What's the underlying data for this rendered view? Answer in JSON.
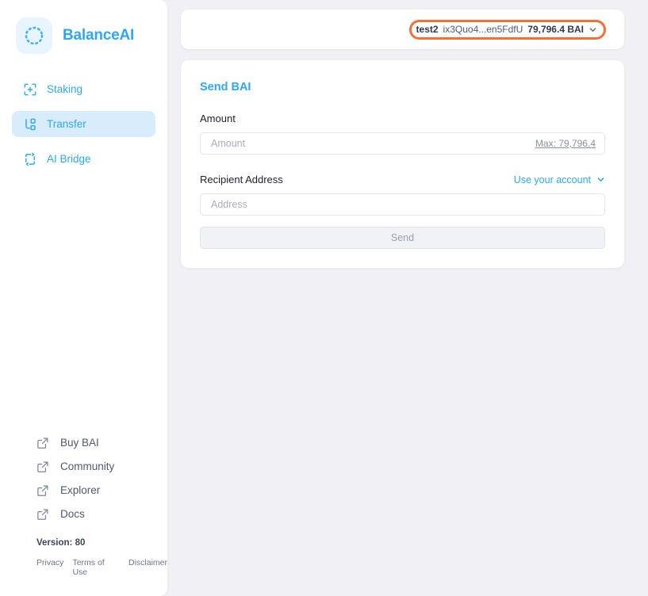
{
  "brand": {
    "name": "BalanceAI",
    "logo_icon": "dashed-circle-logo",
    "accent_color": "#2ea8f0"
  },
  "sidebar": {
    "nav": [
      {
        "label": "Staking",
        "icon": "scan-plus-icon",
        "active": false
      },
      {
        "label": "Transfer",
        "icon": "git-branch-icon",
        "active": true
      },
      {
        "label": "AI Bridge",
        "icon": "refresh-cycle-icon",
        "active": false
      }
    ],
    "external_links": [
      {
        "label": "Buy BAI",
        "icon": "external-link-icon"
      },
      {
        "label": "Community",
        "icon": "external-link-icon"
      },
      {
        "label": "Explorer",
        "icon": "external-link-icon"
      },
      {
        "label": "Docs",
        "icon": "external-link-icon"
      }
    ],
    "version": "Version: 80",
    "legal": [
      {
        "label": "Privacy"
      },
      {
        "label": "Terms of Use"
      },
      {
        "label": "Disclaimer"
      }
    ]
  },
  "topbar": {
    "account": {
      "name": "test2",
      "address": "ix3Quo4...en5FdfU",
      "balance": "79,796.4 BAI",
      "caret_icon": "chevron-down-icon",
      "highlight_color": "#f4703a"
    }
  },
  "send_form": {
    "title": "Send BAI",
    "amount_label": "Amount",
    "amount_value": "",
    "amount_placeholder": "Amount",
    "max_label": "Max: 79,796.4",
    "recipient_label": "Recipient Address",
    "use_account_label": "Use your account",
    "use_account_icon": "chevron-down-icon",
    "address_value": "",
    "address_placeholder": "Address",
    "submit_label": "Send"
  }
}
